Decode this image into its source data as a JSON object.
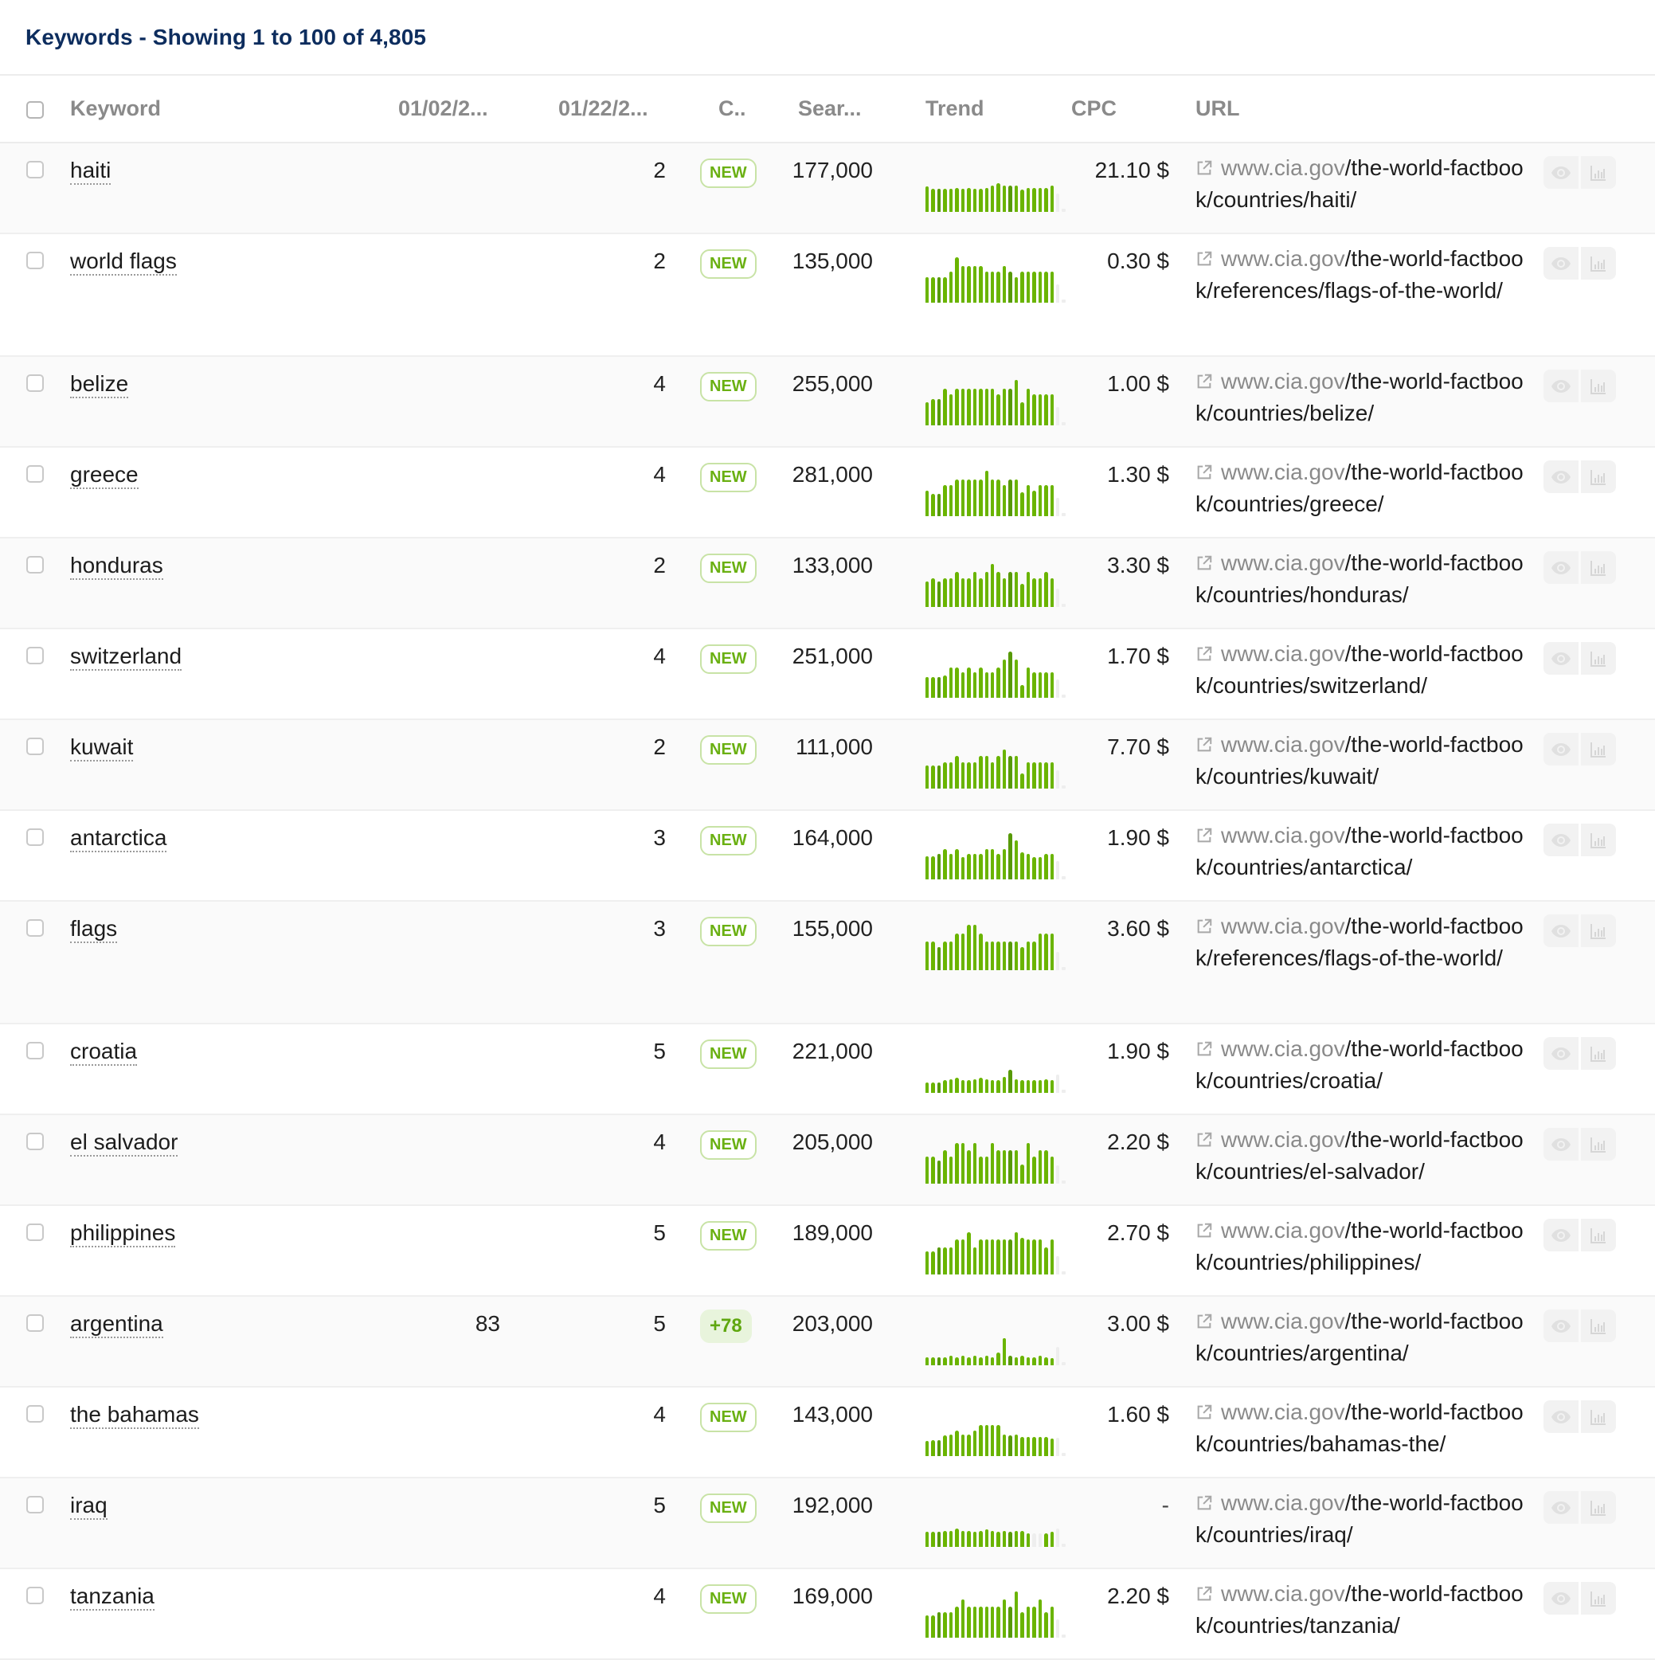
{
  "panel": {
    "title": "Keywords - Showing 1 to 100 of 4,805"
  },
  "columns": {
    "keyword": "Keyword",
    "date1": "01/02/2...",
    "date2": "01/22/2...",
    "change": "C..",
    "search_volume": "Sear...",
    "trend": "Trend",
    "cpc": "CPC",
    "url": "URL"
  },
  "colors": {
    "title": "#0d2d5e",
    "bar": "#6ab400",
    "bar_dark": "#579a06",
    "badge_text": "#6ab012",
    "row_alt": "#fafafa"
  },
  "rows": [
    {
      "keyword": "haiti",
      "date1": "",
      "date2": "2",
      "change": "NEW",
      "change_type": "new",
      "search_volume": "177,000",
      "cpc": "21.10 $",
      "url_host": "www.cia.gov",
      "url_path": "/the-world-factbook/countries/haiti/",
      "trend": [
        0.55,
        0.5,
        0.5,
        0.5,
        0.5,
        0.52,
        0.5,
        0.52,
        0.5,
        0.5,
        0.52,
        0.57,
        0.62,
        0.57,
        0.57,
        0.57,
        0.48,
        0.52,
        0.52,
        0.52,
        0.52,
        0.57
      ]
    },
    {
      "keyword": "world flags",
      "date1": "",
      "date2": "2",
      "change": "NEW",
      "change_type": "new",
      "search_volume": "135,000",
      "cpc": "0.30 $",
      "url_host": "www.cia.gov",
      "url_path": "/the-world-factbook/references/flags-of-the-world/",
      "trend": [
        0.55,
        0.55,
        0.55,
        0.55,
        0.68,
        0.98,
        0.8,
        0.8,
        0.8,
        0.8,
        0.68,
        0.68,
        0.68,
        0.8,
        0.68,
        0.55,
        0.68,
        0.68,
        0.68,
        0.68,
        0.68,
        0.68
      ]
    },
    {
      "keyword": "belize",
      "date1": "",
      "date2": "4",
      "change": "NEW",
      "change_type": "new",
      "search_volume": "255,000",
      "cpc": "1.00 $",
      "url_host": "www.cia.gov",
      "url_path": "/the-world-factbook/countries/belize/",
      "trend": [
        0.5,
        0.57,
        0.57,
        0.8,
        0.67,
        0.8,
        0.8,
        0.8,
        0.8,
        0.8,
        0.8,
        0.8,
        0.67,
        0.8,
        0.8,
        0.98,
        0.5,
        0.8,
        0.67,
        0.67,
        0.67,
        0.67
      ]
    },
    {
      "keyword": "greece",
      "date1": "",
      "date2": "4",
      "change": "NEW",
      "change_type": "new",
      "search_volume": "281,000",
      "cpc": "1.30 $",
      "url_host": "www.cia.gov",
      "url_path": "/the-world-factbook/countries/greece/",
      "trend": [
        0.55,
        0.48,
        0.48,
        0.67,
        0.67,
        0.8,
        0.8,
        0.8,
        0.8,
        0.8,
        0.98,
        0.8,
        0.8,
        0.67,
        0.8,
        0.8,
        0.52,
        0.67,
        0.55,
        0.67,
        0.67,
        0.67
      ]
    },
    {
      "keyword": "honduras",
      "date1": "",
      "date2": "2",
      "change": "NEW",
      "change_type": "new",
      "search_volume": "133,000",
      "cpc": "3.30 $",
      "url_host": "www.cia.gov",
      "url_path": "/the-world-factbook/countries/honduras/",
      "trend": [
        0.55,
        0.62,
        0.55,
        0.62,
        0.62,
        0.75,
        0.62,
        0.62,
        0.75,
        0.62,
        0.75,
        0.93,
        0.75,
        0.62,
        0.75,
        0.75,
        0.5,
        0.75,
        0.62,
        0.62,
        0.75,
        0.62
      ]
    },
    {
      "keyword": "switzerland",
      "date1": "",
      "date2": "4",
      "change": "NEW",
      "change_type": "new",
      "search_volume": "251,000",
      "cpc": "1.70 $",
      "url_host": "www.cia.gov",
      "url_path": "/the-world-factbook/countries/switzerland/",
      "trend": [
        0.45,
        0.45,
        0.45,
        0.48,
        0.65,
        0.65,
        0.55,
        0.65,
        0.55,
        0.65,
        0.55,
        0.55,
        0.65,
        0.82,
        1.0,
        0.82,
        0.27,
        0.65,
        0.55,
        0.55,
        0.55,
        0.55
      ]
    },
    {
      "keyword": "kuwait",
      "date1": "",
      "date2": "2",
      "change": "NEW",
      "change_type": "new",
      "search_volume": "111,000",
      "cpc": "7.70 $",
      "url_host": "www.cia.gov",
      "url_path": "/the-world-factbook/countries/kuwait/",
      "trend": [
        0.5,
        0.5,
        0.5,
        0.57,
        0.57,
        0.7,
        0.57,
        0.57,
        0.57,
        0.7,
        0.7,
        0.57,
        0.7,
        0.85,
        0.7,
        0.7,
        0.32,
        0.57,
        0.57,
        0.57,
        0.57,
        0.57
      ]
    },
    {
      "keyword": "antarctica",
      "date1": "",
      "date2": "3",
      "change": "NEW",
      "change_type": "new",
      "search_volume": "164,000",
      "cpc": "1.90 $",
      "url_host": "www.cia.gov",
      "url_path": "/the-world-factbook/countries/antarctica/",
      "trend": [
        0.5,
        0.5,
        0.55,
        0.65,
        0.55,
        0.65,
        0.48,
        0.55,
        0.55,
        0.55,
        0.65,
        0.65,
        0.55,
        0.65,
        1.0,
        0.85,
        0.58,
        0.55,
        0.48,
        0.48,
        0.55,
        0.55
      ]
    },
    {
      "keyword": "flags",
      "date1": "",
      "date2": "3",
      "change": "NEW",
      "change_type": "new",
      "search_volume": "155,000",
      "cpc": "3.60 $",
      "url_host": "www.cia.gov",
      "url_path": "/the-world-factbook/references/flags-of-the-world/",
      "trend": [
        0.62,
        0.62,
        0.5,
        0.62,
        0.62,
        0.8,
        0.8,
        0.98,
        0.98,
        0.8,
        0.62,
        0.62,
        0.62,
        0.62,
        0.62,
        0.62,
        0.5,
        0.62,
        0.62,
        0.8,
        0.8,
        0.8
      ]
    },
    {
      "keyword": "croatia",
      "date1": "",
      "date2": "5",
      "change": "NEW",
      "change_type": "new",
      "search_volume": "221,000",
      "cpc": "1.90 $",
      "url_host": "www.cia.gov",
      "url_path": "/the-world-factbook/countries/croatia/",
      "trend": [
        0.22,
        0.22,
        0.22,
        0.27,
        0.3,
        0.32,
        0.28,
        0.28,
        0.3,
        0.32,
        0.3,
        0.28,
        0.28,
        0.35,
        0.5,
        0.3,
        0.27,
        0.28,
        0.27,
        0.28,
        0.3,
        0.28
      ]
    },
    {
      "keyword": "el salvador",
      "date1": "",
      "date2": "4",
      "change": "NEW",
      "change_type": "new",
      "search_volume": "205,000",
      "cpc": "2.20 $",
      "url_host": "www.cia.gov",
      "url_path": "/the-world-factbook/countries/el-salvador/",
      "trend": [
        0.58,
        0.58,
        0.5,
        0.72,
        0.58,
        0.88,
        0.88,
        0.72,
        0.88,
        0.58,
        0.58,
        0.88,
        0.72,
        0.72,
        0.72,
        0.72,
        0.42,
        0.88,
        0.58,
        0.72,
        0.72,
        0.58
      ]
    },
    {
      "keyword": "philippines",
      "date1": "",
      "date2": "5",
      "change": "NEW",
      "change_type": "new",
      "search_volume": "189,000",
      "cpc": "2.70 $",
      "url_host": "www.cia.gov",
      "url_path": "/the-world-factbook/countries/philippines/",
      "trend": [
        0.5,
        0.5,
        0.58,
        0.58,
        0.58,
        0.75,
        0.75,
        0.92,
        0.58,
        0.75,
        0.75,
        0.75,
        0.75,
        0.75,
        0.75,
        0.92,
        0.8,
        0.75,
        0.75,
        0.75,
        0.58,
        0.75
      ]
    },
    {
      "keyword": "argentina",
      "date1": "83",
      "date2": "5",
      "change": "+78",
      "change_type": "delta",
      "search_volume": "203,000",
      "cpc": "3.00 $",
      "url_host": "www.cia.gov",
      "url_path": "/the-world-factbook/countries/argentina/",
      "trend": [
        0.18,
        0.17,
        0.17,
        0.18,
        0.2,
        0.18,
        0.2,
        0.18,
        0.2,
        0.18,
        0.2,
        0.18,
        0.28,
        0.58,
        0.2,
        0.18,
        0.2,
        0.18,
        0.18,
        0.2,
        0.18,
        0.15
      ]
    },
    {
      "keyword": "the bahamas",
      "date1": "",
      "date2": "4",
      "change": "NEW",
      "change_type": "new",
      "search_volume": "143,000",
      "cpc": "1.60 $",
      "url_host": "www.cia.gov",
      "url_path": "/the-world-factbook/countries/bahamas-the/",
      "trend": [
        0.32,
        0.35,
        0.35,
        0.45,
        0.47,
        0.55,
        0.47,
        0.47,
        0.55,
        0.67,
        0.67,
        0.67,
        0.67,
        0.47,
        0.45,
        0.47,
        0.42,
        0.42,
        0.42,
        0.42,
        0.42,
        0.38
      ]
    },
    {
      "keyword": "iraq",
      "date1": "",
      "date2": "5",
      "change": "NEW",
      "change_type": "new",
      "search_volume": "192,000",
      "cpc": "-",
      "url_host": "www.cia.gov",
      "url_path": "/the-world-factbook/countries/iraq/",
      "trend": [
        0.33,
        0.33,
        0.33,
        0.35,
        0.35,
        0.4,
        0.35,
        0.35,
        0.33,
        0.35,
        0.38,
        0.35,
        0.33,
        0.35,
        0.33,
        0.35,
        0.35,
        0.3,
        null,
        null,
        0.3,
        0.33
      ]
    },
    {
      "keyword": "tanzania",
      "date1": "",
      "date2": "4",
      "change": "NEW",
      "change_type": "new",
      "search_volume": "169,000",
      "cpc": "2.20 $",
      "url_host": "www.cia.gov",
      "url_path": "/the-world-factbook/countries/tanzania/",
      "trend": [
        0.48,
        0.48,
        0.55,
        0.55,
        0.55,
        0.68,
        0.82,
        0.68,
        0.68,
        0.68,
        0.68,
        0.68,
        0.68,
        0.82,
        0.68,
        1.0,
        0.55,
        0.68,
        0.68,
        0.82,
        0.55,
        0.68
      ]
    }
  ]
}
